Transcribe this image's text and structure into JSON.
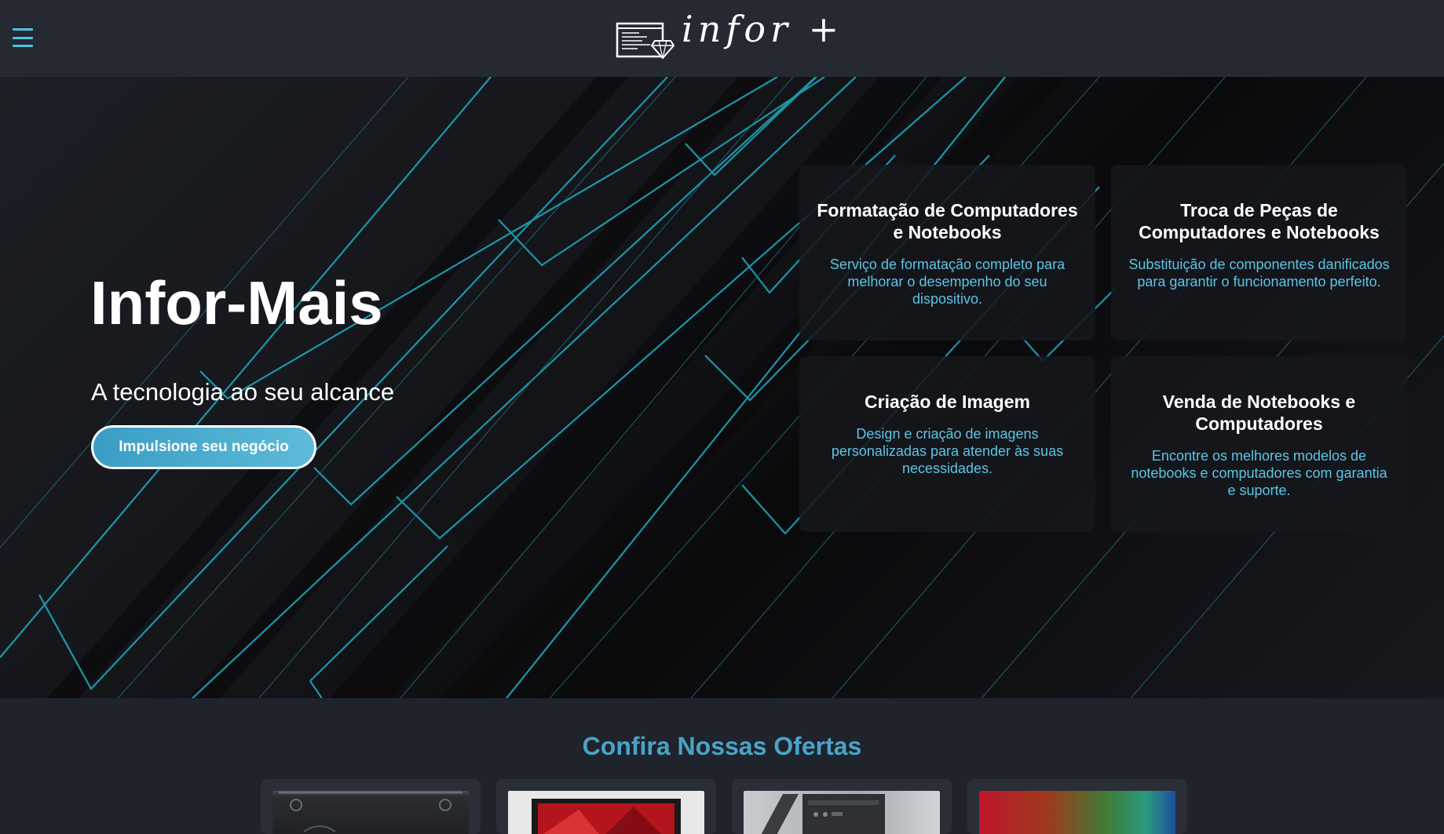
{
  "header": {
    "menu_icon": "hamburger-menu-icon",
    "logo_text": "infor +",
    "logo_icon": "code-window-diamond-icon"
  },
  "hero": {
    "title": "Infor-Mais",
    "subtitle": "A tecnologia ao seu alcance",
    "cta_label": "Impulsione seu negócio"
  },
  "services": [
    {
      "title": "Formatação de Computadores e Notebooks",
      "description": "Serviço de formatação completo para melhorar o desempenho do seu dispositivo."
    },
    {
      "title": "Troca de Peças de Computadores e Notebooks",
      "description": "Substituição de componentes danificados para garantir o funcionamento perfeito."
    },
    {
      "title": "Criação de Imagem",
      "description": "Design e criação de imagens personalizadas para atender às suas necessidades."
    },
    {
      "title": "Venda de Notebooks e Computadores",
      "description": "Encontre os melhores modelos de notebooks e computadores com garantia e suporte."
    }
  ],
  "offers": {
    "title": "Confira Nossas Ofertas",
    "products": [
      {
        "image": "product-hardware-dark-image"
      },
      {
        "image": "product-notebook-red-image"
      },
      {
        "image": "product-desktop-case-image"
      },
      {
        "image": "product-rgb-notebook-image"
      }
    ]
  },
  "colors": {
    "accent": "#4cc3e0",
    "card_text": "#5cc5e6",
    "offers_title": "#4aa3c8",
    "header_bg": "#252932"
  }
}
